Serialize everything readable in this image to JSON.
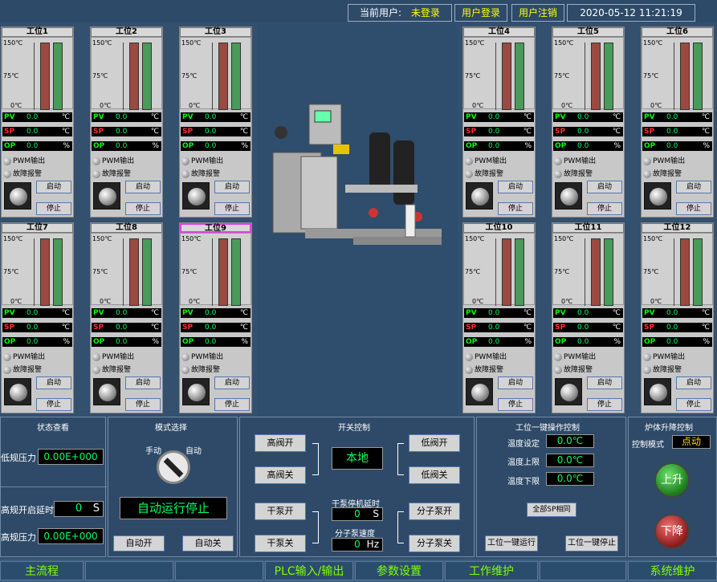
{
  "header": {
    "current_user_label": "当前用户:",
    "current_user_value": "未登录",
    "login_label": "用户登录",
    "logout_label": "用户注销",
    "datetime": "2020-05-12 11:21:19"
  },
  "gauge_ticks": [
    "150℃",
    "75℃",
    "0℃"
  ],
  "stations": [
    {
      "title": "工位1",
      "pv": "0.0",
      "sp": "0.0",
      "op": "0.0",
      "pv_unit": "℃",
      "sp_unit": "℃",
      "op_unit": "%",
      "pwm": "PWM输出",
      "fault": "故障报警",
      "start": "启动",
      "stop": "停止",
      "pv_label": "PV",
      "sp_label": "SP",
      "op_label": "OP"
    },
    {
      "title": "工位2",
      "pv": "0.0",
      "sp": "0.0",
      "op": "0.0",
      "pv_unit": "℃",
      "sp_unit": "℃",
      "op_unit": "%",
      "pwm": "PWM输出",
      "fault": "故障报警",
      "start": "启动",
      "stop": "停止",
      "pv_label": "PV",
      "sp_label": "SP",
      "op_label": "OP"
    },
    {
      "title": "工位3",
      "pv": "0.0",
      "sp": "0.0",
      "op": "0.0",
      "pv_unit": "℃",
      "sp_unit": "℃",
      "op_unit": "%",
      "pwm": "PWM输出",
      "fault": "故障报警",
      "start": "启动",
      "stop": "停止",
      "pv_label": "PV",
      "sp_label": "SP",
      "op_label": "OP"
    },
    {
      "title": "工位4",
      "pv": "0.0",
      "sp": "0.0",
      "op": "0.0",
      "pv_unit": "℃",
      "sp_unit": "℃",
      "op_unit": "%",
      "pwm": "PWM输出",
      "fault": "故障报警",
      "start": "启动",
      "stop": "停止",
      "pv_label": "PV",
      "sp_label": "SP",
      "op_label": "OP"
    },
    {
      "title": "工位5",
      "pv": "0.0",
      "sp": "0.0",
      "op": "0.0",
      "pv_unit": "℃",
      "sp_unit": "℃",
      "op_unit": "%",
      "pwm": "PWM输出",
      "fault": "故障报警",
      "start": "启动",
      "stop": "停止",
      "pv_label": "PV",
      "sp_label": "SP",
      "op_label": "OP"
    },
    {
      "title": "工位6",
      "pv": "0.0",
      "sp": "0.0",
      "op": "0.0",
      "pv_unit": "℃",
      "sp_unit": "℃",
      "op_unit": "%",
      "pwm": "PWM输出",
      "fault": "故障报警",
      "start": "启动",
      "stop": "停止",
      "pv_label": "PV",
      "sp_label": "SP",
      "op_label": "OP"
    },
    {
      "title": "工位7",
      "pv": "0.0",
      "sp": "0.0",
      "op": "0.0",
      "pv_unit": "℃",
      "sp_unit": "℃",
      "op_unit": "%",
      "pwm": "PWM输出",
      "fault": "故障报警",
      "start": "启动",
      "stop": "停止",
      "pv_label": "PV",
      "sp_label": "SP",
      "op_label": "OP"
    },
    {
      "title": "工位8",
      "pv": "0.0",
      "sp": "0.0",
      "op": "0.0",
      "pv_unit": "℃",
      "sp_unit": "℃",
      "op_unit": "%",
      "pwm": "PWM输出",
      "fault": "故障报警",
      "start": "启动",
      "stop": "停止",
      "pv_label": "PV",
      "sp_label": "SP",
      "op_label": "OP"
    },
    {
      "title": "工位9",
      "pv": "0.0",
      "sp": "0.0",
      "op": "0.0",
      "pv_unit": "℃",
      "sp_unit": "℃",
      "op_unit": "%",
      "pwm": "PWM输出",
      "fault": "故障报警",
      "start": "启动",
      "stop": "停止",
      "pv_label": "PV",
      "sp_label": "SP",
      "op_label": "OP"
    },
    {
      "title": "工位10",
      "pv": "0.0",
      "sp": "0.0",
      "op": "0.0",
      "pv_unit": "℃",
      "sp_unit": "℃",
      "op_unit": "%",
      "pwm": "PWM输出",
      "fault": "故障报警",
      "start": "启动",
      "stop": "停止",
      "pv_label": "PV",
      "sp_label": "SP",
      "op_label": "OP"
    },
    {
      "title": "工位11",
      "pv": "0.0",
      "sp": "0.0",
      "op": "0.0",
      "pv_unit": "℃",
      "sp_unit": "℃",
      "op_unit": "%",
      "pwm": "PWM输出",
      "fault": "故障报警",
      "start": "启动",
      "stop": "停止",
      "pv_label": "PV",
      "sp_label": "SP",
      "op_label": "OP"
    },
    {
      "title": "工位12",
      "pv": "0.0",
      "sp": "0.0",
      "op": "0.0",
      "pv_unit": "℃",
      "sp_unit": "℃",
      "op_unit": "%",
      "pwm": "PWM输出",
      "fault": "故障报警",
      "start": "启动",
      "stop": "停止",
      "pv_label": "PV",
      "sp_label": "SP",
      "op_label": "OP"
    }
  ],
  "status_panel": {
    "title": "状态查看",
    "low_pressure_label": "低规压力",
    "low_pressure_value": "0.00E+000",
    "high_open_delay_label": "高规开启延时",
    "high_open_delay_value": "0",
    "high_open_delay_unit": "S",
    "high_pressure_label": "高规压力",
    "high_pressure_value": "0.00E+000"
  },
  "mode_panel": {
    "title": "模式选择",
    "manual_label": "手动",
    "auto_label": "自动",
    "status_text": "自动运行停止",
    "auto_on_label": "自动开",
    "auto_off_label": "自动关"
  },
  "switch_panel": {
    "title": "开关控制",
    "high_valve_open": "高阀开",
    "high_valve_close": "高阀关",
    "low_valve_open": "低阀开",
    "low_valve_close": "低阀关",
    "local_label": "本地",
    "dry_pump_open": "干泵开",
    "dry_pump_close": "干泵关",
    "mol_pump_open": "分子泵开",
    "mol_pump_close": "分子泵关",
    "dry_stop_delay_label": "干泵停机延时",
    "dry_stop_delay_value": "0",
    "dry_stop_delay_unit": "S",
    "mol_speed_label": "分子泵速度",
    "mol_speed_value": "0",
    "mol_speed_unit": "Hz"
  },
  "station_ctrl_panel": {
    "title": "工位一键操作控制",
    "temp_set_label": "温度设定",
    "temp_set_value": "0.0℃",
    "temp_upper_label": "温度上限",
    "temp_upper_value": "0.0℃",
    "temp_lower_label": "温度下限",
    "temp_lower_value": "0.0℃",
    "all_sp_label": "全部SP相同",
    "run_all_label": "工位一键运行",
    "stop_all_label": "工位一键停止"
  },
  "lift_panel": {
    "title": "炉体升降控制",
    "mode_label": "控制模式",
    "mode_value": "点动",
    "up_label": "上升",
    "down_label": "下降"
  },
  "nav": {
    "main_flow": "主流程",
    "plc_io": "PLC输入/输出",
    "param_settings": "参数设置",
    "work_maintenance": "工作维护",
    "system_maintenance": "系统维护"
  },
  "colors": {
    "background": "#33506f",
    "pv_label": "#00ff00",
    "sp_label": "#ff3030",
    "op_label": "#00ff00",
    "value_text": "#00ff60",
    "nav_text": "#7fff00",
    "up_button": "#2e8a2e",
    "down_button": "#a02828"
  }
}
